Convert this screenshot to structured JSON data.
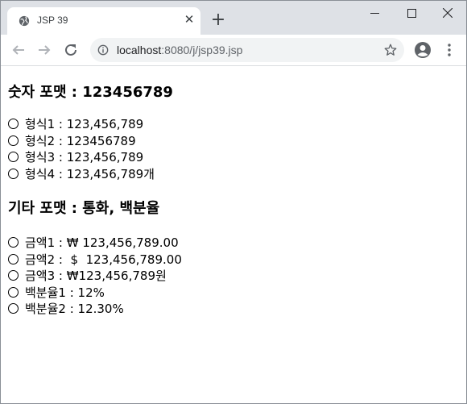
{
  "browser": {
    "tab_title": "JSP 39",
    "url_host": "localhost",
    "url_rest": ":8080/j/jsp39.jsp"
  },
  "page": {
    "heading1": "숫자 포맷 : 123456789",
    "numbers": [
      "형식1 : 123,456,789",
      "형식2 : 123456789",
      "형식3 : 123,456,789",
      "형식4 : 123,456,789개"
    ],
    "heading2": "기타 포맷 : 통화, 백분율",
    "others": [
      "금액1 : ₩ 123,456,789.00",
      "금액2 :  $  123,456,789.00",
      "금액3 : ₩123,456,789원",
      "백분율1 : 12%",
      "백분율2 : 12.30%"
    ]
  },
  "icons": {
    "favicon": "globe-icon",
    "close": "close-icon",
    "new_tab": "plus-icon",
    "back": "back-arrow-icon",
    "forward": "forward-arrow-icon",
    "reload": "reload-icon",
    "info": "info-icon",
    "star": "star-icon",
    "profile": "profile-icon",
    "menu": "kebab-menu-icon"
  }
}
